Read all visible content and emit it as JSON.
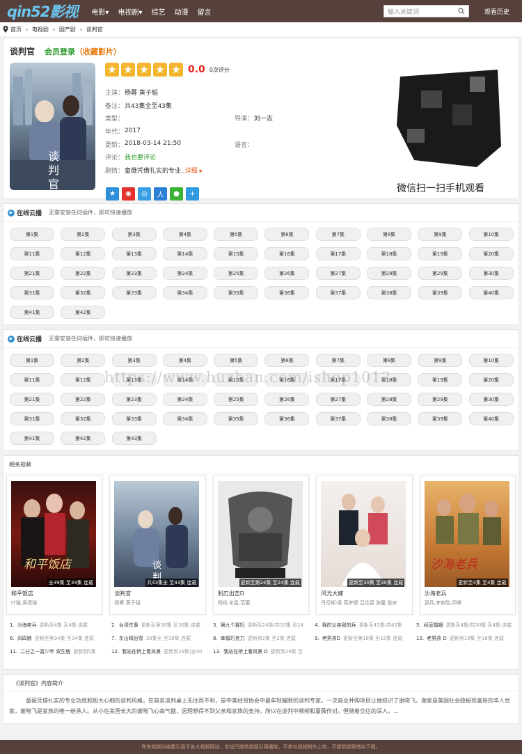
{
  "header": {
    "logo": "qin52影视",
    "nav": [
      "电影▾",
      "电视剧▾",
      "综艺",
      "动漫",
      "留言"
    ],
    "search_placeholder": "输入关键词",
    "history": "观看历史"
  },
  "breadcrumb": [
    "首页",
    "电视剧",
    "国产剧",
    "谈判官"
  ],
  "detail": {
    "title": "谈判官",
    "login": "会员登录",
    "fav": "（收藏影片）",
    "score": "0.0",
    "score_count": "0次评分",
    "actors_label": "主演：",
    "actors": "杨幂  黄子韬",
    "note_label": "备注：",
    "note": "共43集全至43集",
    "type_label": "类型：",
    "type": "",
    "director_label": "导演：",
    "director": "刘一志",
    "year_label": "年代：",
    "year": "2017",
    "update_label": "更新：",
    "update": "2018-03-14 21:50",
    "lang_label": "语言：",
    "lang": "",
    "comment_label": "评论：",
    "comment": "我也要评论",
    "plot_label": "剧情：",
    "plot": "童薇凭借扎实的专业..",
    "plot_more": "详细 ▸",
    "qr_caption": "微信扫一扫手机观看"
  },
  "play1": {
    "name": "在线云播",
    "tip": "无需安装任何插件，即可快速播放",
    "episodes": [
      "第1集",
      "第2集",
      "第3集",
      "第4集",
      "第5集",
      "第6集",
      "第7集",
      "第8集",
      "第9集",
      "第10集",
      "第11集",
      "第12集",
      "第13集",
      "第14集",
      "第15集",
      "第16集",
      "第17集",
      "第18集",
      "第19集",
      "第20集",
      "第21集",
      "第22集",
      "第23集",
      "第24集",
      "第25集",
      "第26集",
      "第27集",
      "第28集",
      "第29集",
      "第30集",
      "第31集",
      "第32集",
      "第33集",
      "第34集",
      "第35集",
      "第36集",
      "第37集",
      "第38集",
      "第39集",
      "第40集",
      "第41集",
      "第42集"
    ]
  },
  "play2": {
    "name": "在线云播",
    "tip": "无需安装任何插件，即可快速播放",
    "episodes": [
      "第1集",
      "第2集",
      "第3集",
      "第4集",
      "第5集",
      "第6集",
      "第7集",
      "第8集",
      "第9集",
      "第10集",
      "第11集",
      "第12集",
      "第13集",
      "第14集",
      "第15集",
      "第16集",
      "第17集",
      "第18集",
      "第19集",
      "第20集",
      "第21集",
      "第22集",
      "第23集",
      "第24集",
      "第25集",
      "第26集",
      "第27集",
      "第28集",
      "第29集",
      "第30集",
      "第31集",
      "第32集",
      "第33集",
      "第34集",
      "第35集",
      "第36集",
      "第37集",
      "第38集",
      "第39集",
      "第40集",
      "第41集",
      "第42集",
      "第43集"
    ]
  },
  "watermark": "https://www.huzhan.com/ishop1012",
  "related": {
    "title": "相关视频",
    "cards": [
      {
        "name": "和平饭店",
        "actors": "叶璇,吴倩瑜",
        "badge": "全39集 至39集 连载"
      },
      {
        "name": "谈判官",
        "actors": "杨幂  黄子韬",
        "badge": "共43集全 至43集 连载"
      },
      {
        "name": "利刃出击D",
        "actors": "杨烁,牟星,范蕾",
        "badge": "更新至第24集 至24集 连载"
      },
      {
        "name": "风光大嫁",
        "actors": "丹尼斯·吴 蒋梦婕 吕佳容 张馨 是安",
        "badge": "更新至30集 至30集 连载"
      },
      {
        "name": "沙海老兵",
        "actors": "邵兵,李依晓,邱峰",
        "badge": "更新至4集 至4集 连载"
      }
    ]
  },
  "ranking": [
    {
      "n": "1.",
      "t": "沙海老兵",
      "s": "更新至4集 至4集 连载"
    },
    {
      "n": "2.",
      "t": "台湾往事",
      "s": "更新至第36集 至36集 连载"
    },
    {
      "n": "3.",
      "t": "第九个寡妇",
      "s": "更新至24集/共33集 至24"
    },
    {
      "n": "4.",
      "t": "我的父亲我的兵",
      "s": "更新至43集/共43集"
    },
    {
      "n": "5.",
      "t": "经营婚姻",
      "s": "更新至4集/共30集 至4集 连载"
    },
    {
      "n": "6.",
      "t": "风四娘",
      "s": "更新至第34集 至34集 连载"
    },
    {
      "n": "7.",
      "t": "东山晴后雪",
      "s": "38集全 至38集 连载"
    },
    {
      "n": "8.",
      "t": "幸福巧克力",
      "s": "更新到2集 至2集 连载"
    },
    {
      "n": "9.",
      "t": "老男孩D",
      "s": "更新至第18集 至18集 连载"
    },
    {
      "n": "10.",
      "t": "老男孩 D",
      "s": "更新到18集 至18集 连载"
    },
    {
      "n": "11.",
      "t": "二分之一富少年 双生版",
      "s": "更新到5集"
    },
    {
      "n": "12.",
      "t": "我站在桥上看风景",
      "s": "更新到29集|全40"
    },
    {
      "n": "13.",
      "t": "我站在桥上看风景 D",
      "s": "更新到29集 至"
    }
  ],
  "intro": {
    "title": "《谈判官》内容简介",
    "text": "童薇凭借扎实的专业功底和胆大心细的谈判风格，在商务谈判桌上无往而不利，是中美经贸协会中最年轻耀眼的谈判专家。一次商业并购项目让她结识了谢晓飞。谢家是美国社会隐秘而富裕的华人世家，谢晓飞是家族的唯一继承人。从小在美国长大的谢晓飞心高气傲，因理想得不到父亲和家族的支持，所以在谈判中频频和童薇作对。但随着交往的深入，..."
  },
  "footer": "所有视频均收集引用于各大视频网站，本站只提供视频引用播放，不参与视频制作上传，不提供视频储存下载。"
}
